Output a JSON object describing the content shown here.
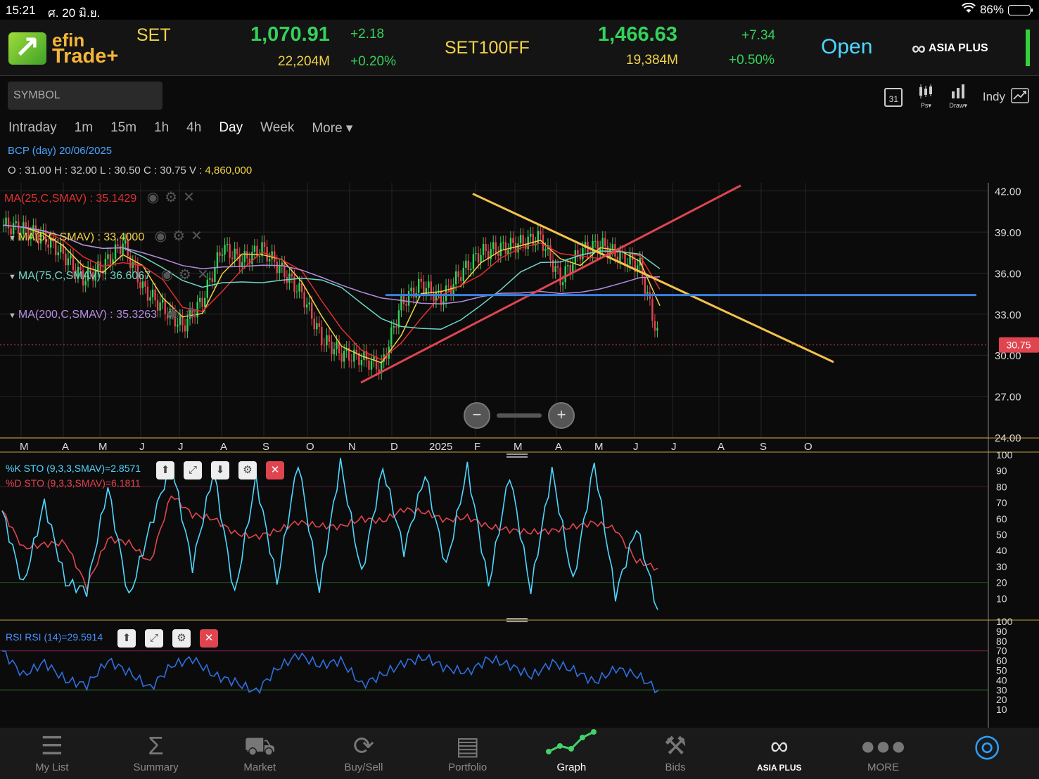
{
  "status": {
    "time": "15:21",
    "date": "ศ. 20 มิ.ย.",
    "battery": "86%"
  },
  "header": {
    "logo_top": "efin",
    "logo_bottom": "Trade+",
    "set_label": "SET",
    "set_value": "1,070.91",
    "set_change": "+2.18",
    "set_volume": "22,204M",
    "set_pct": "+0.20%",
    "set100_label": "SET100FF",
    "set100_value": "1,466.63",
    "set100_change": "+7.34",
    "set100_volume": "19,384M",
    "set100_pct": "+0.50%",
    "market_status": "Open",
    "broker": "ASIA PLUS"
  },
  "toolbar": {
    "symbol_placeholder": "SYMBOL",
    "calendar_day": "31",
    "ps_label": "Ps▾",
    "draw_label": "Draw▾",
    "indy_label": "Indy",
    "timeframes": [
      "Intraday",
      "1m",
      "15m",
      "1h",
      "4h",
      "Day",
      "Week",
      "More ▾"
    ],
    "active_timeframe": "Day"
  },
  "quote": {
    "title": "BCP (day) 20/06/2025",
    "o": "O : 31.00",
    "h": "H : 32.00",
    "l": "L : 30.50",
    "c": "C : 30.75",
    "v_label": "V : ",
    "v_value": "4,860,000"
  },
  "legends": {
    "ma1": "MA(25,C,SMAV) : 35.1429",
    "ma2": "MA(5,C,SMAV) : 33.4000",
    "ma3": "MA(75,C,SMAV) : 36.6067",
    "ma4": "MA(200,C,SMAV) : 35.3263",
    "sto_k": "%K STO (9,3,3,SMAV)=2.8571",
    "sto_d": "%D STO (9,3,3,SMAV)=6.1811",
    "rsi": "RSI RSI (14)=29.5914"
  },
  "colors": {
    "up": "#34d15a",
    "down": "#e0454f",
    "ma5": "#f3d24a",
    "ma25": "#e03030",
    "ma75": "#6fd6c6",
    "ma200": "#b58be0",
    "trend_yellow": "#f5c24a",
    "trend_red": "#e0454f",
    "support_blue": "#3a7fe0",
    "sto_k": "#4fd7ff",
    "sto_d": "#e0454f",
    "rsi": "#2f6fe0"
  },
  "chart_data": {
    "type": "line",
    "title": "BCP (day) 20/06/2025",
    "price_axis": [
      "42.00",
      "39.00",
      "36.00",
      "33.00",
      "30.00",
      "27.00",
      "24.00"
    ],
    "ylim": [
      24,
      42.6
    ],
    "last_price": "30.75",
    "x_labels": [
      "M",
      "A",
      "M",
      "J",
      "J",
      "A",
      "S",
      "O",
      "N",
      "D",
      "2025",
      "F",
      "M",
      "A",
      "M",
      "J",
      "J",
      "A",
      "S",
      "O"
    ],
    "close_series": [
      39.5,
      39.2,
      38.6,
      37.4,
      35.6,
      36.5,
      38.2,
      34.9,
      33.5,
      32.1,
      34.0,
      37.9,
      36.9,
      37.8,
      36.2,
      34.5,
      31.2,
      30.1,
      29.8,
      29.1,
      33.8,
      35.2,
      34.1,
      36.0,
      37.5,
      37.8,
      38.2,
      38.6,
      35.5,
      37.6,
      38.1,
      37.2,
      36.5,
      30.75
    ],
    "sto_axis": [
      "100",
      "90",
      "80",
      "70",
      "60",
      "50",
      "40",
      "30",
      "20",
      "10"
    ],
    "sto_k": [
      65,
      18,
      70,
      20,
      15,
      80,
      10,
      55,
      95,
      30,
      90,
      12,
      85,
      20,
      96,
      15,
      95,
      25,
      92,
      40,
      88,
      30,
      92,
      18,
      88,
      15,
      90,
      20,
      95,
      12,
      55,
      3
    ],
    "rsi_axis": [
      "100",
      "90",
      "80",
      "70",
      "60",
      "50",
      "40",
      "30",
      "20",
      "10"
    ],
    "rsi_values": [
      70,
      45,
      58,
      40,
      35,
      60,
      48,
      32,
      55,
      62,
      45,
      38,
      28,
      52,
      66,
      55,
      60,
      35,
      46,
      58,
      63,
      52,
      48,
      62,
      55,
      44,
      58,
      50,
      38,
      52,
      45,
      29.6
    ]
  },
  "tabs": [
    {
      "label": "My List",
      "icon": "list-icon"
    },
    {
      "label": "Summary",
      "icon": "sigma-icon"
    },
    {
      "label": "Market",
      "icon": "cart-icon"
    },
    {
      "label": "Buy/Sell",
      "icon": "exchange-icon"
    },
    {
      "label": "Portfolio",
      "icon": "document-icon"
    },
    {
      "label": "Graph",
      "icon": "graph-icon"
    },
    {
      "label": "Bids",
      "icon": "gavel-icon"
    },
    {
      "label": "ASIA PLUS",
      "icon": "infinity-icon"
    },
    {
      "label": "MORE",
      "icon": "dots-icon"
    },
    {
      "label": "",
      "icon": "refresh-icon"
    }
  ]
}
